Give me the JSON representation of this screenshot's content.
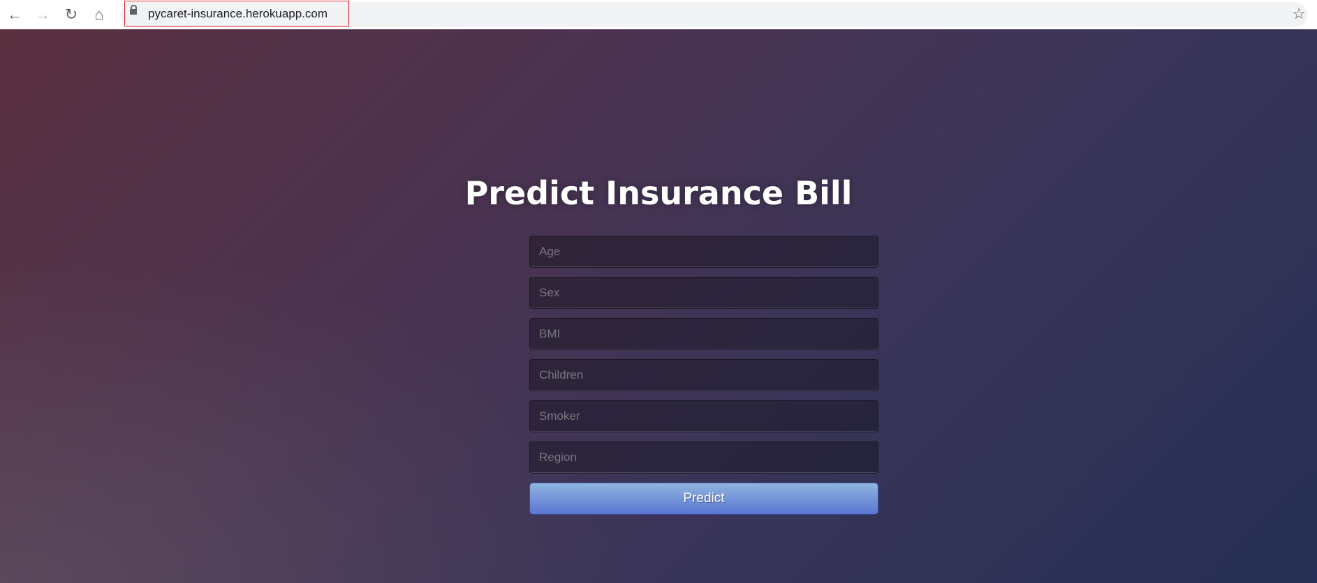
{
  "browser": {
    "url": "pycaret-insurance.herokuapp.com",
    "icons": [
      "back-icon",
      "forward-icon",
      "reload-icon",
      "home-icon",
      "lock-icon",
      "star-icon"
    ]
  },
  "page": {
    "title": "Predict Insurance Bill",
    "fields": [
      {
        "placeholder": "Age",
        "value": ""
      },
      {
        "placeholder": "Sex",
        "value": ""
      },
      {
        "placeholder": "BMI",
        "value": ""
      },
      {
        "placeholder": "Children",
        "value": ""
      },
      {
        "placeholder": "Smoker",
        "value": ""
      },
      {
        "placeholder": "Region",
        "value": ""
      }
    ],
    "submit_label": "Predict"
  },
  "colors": {
    "button_top": "#8fb5e0",
    "button_bottom": "#5a76d2",
    "highlight_box": "#e01c24"
  }
}
